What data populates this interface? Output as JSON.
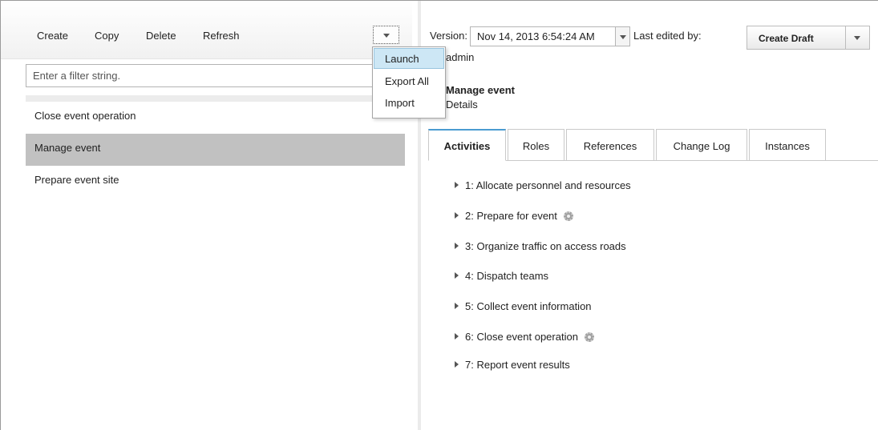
{
  "toolbar": {
    "create_label": "Create",
    "copy_label": "Copy",
    "delete_label": "Delete",
    "refresh_label": "Refresh"
  },
  "filter": {
    "placeholder": "Enter a filter string."
  },
  "process_list": [
    {
      "label": "Close event operation",
      "selected": false
    },
    {
      "label": "Manage event",
      "selected": true
    },
    {
      "label": "Prepare event site",
      "selected": false
    }
  ],
  "menu": {
    "items": [
      {
        "label": "Launch",
        "active": true
      },
      {
        "label": "Export All",
        "active": false
      },
      {
        "label": "Import",
        "active": false
      }
    ]
  },
  "version": {
    "label": "Version:",
    "value": "Nov 14, 2013 6:54:24 AM",
    "last_edited_label": "Last edited by:",
    "last_edited_value": "admin"
  },
  "create_draft_label": "Create Draft",
  "process": {
    "name": "Manage event",
    "subtitle": "Details"
  },
  "tabs": [
    {
      "label": "Activities",
      "active": true
    },
    {
      "label": "Roles",
      "active": false
    },
    {
      "label": "References",
      "active": false
    },
    {
      "label": "Change Log",
      "active": false
    },
    {
      "label": "Instances",
      "active": false
    }
  ],
  "activities": [
    {
      "label": "1: Allocate personnel and resources",
      "icon": ""
    },
    {
      "label": "2: Prepare for event",
      "icon": "gear-icon"
    },
    {
      "label": "3: Organize traffic on access roads",
      "icon": ""
    },
    {
      "label": "4: Dispatch teams",
      "icon": ""
    },
    {
      "label": "5: Collect event information",
      "icon": ""
    },
    {
      "label": "6: Close event operation",
      "icon": "gear-icon"
    },
    {
      "label": "7: Report event results",
      "icon": ""
    }
  ],
  "colors": {
    "selected_row": "#c1c1c1",
    "menu_highlight": "#cde7f5",
    "active_tab_accent": "#4a9bd1"
  }
}
